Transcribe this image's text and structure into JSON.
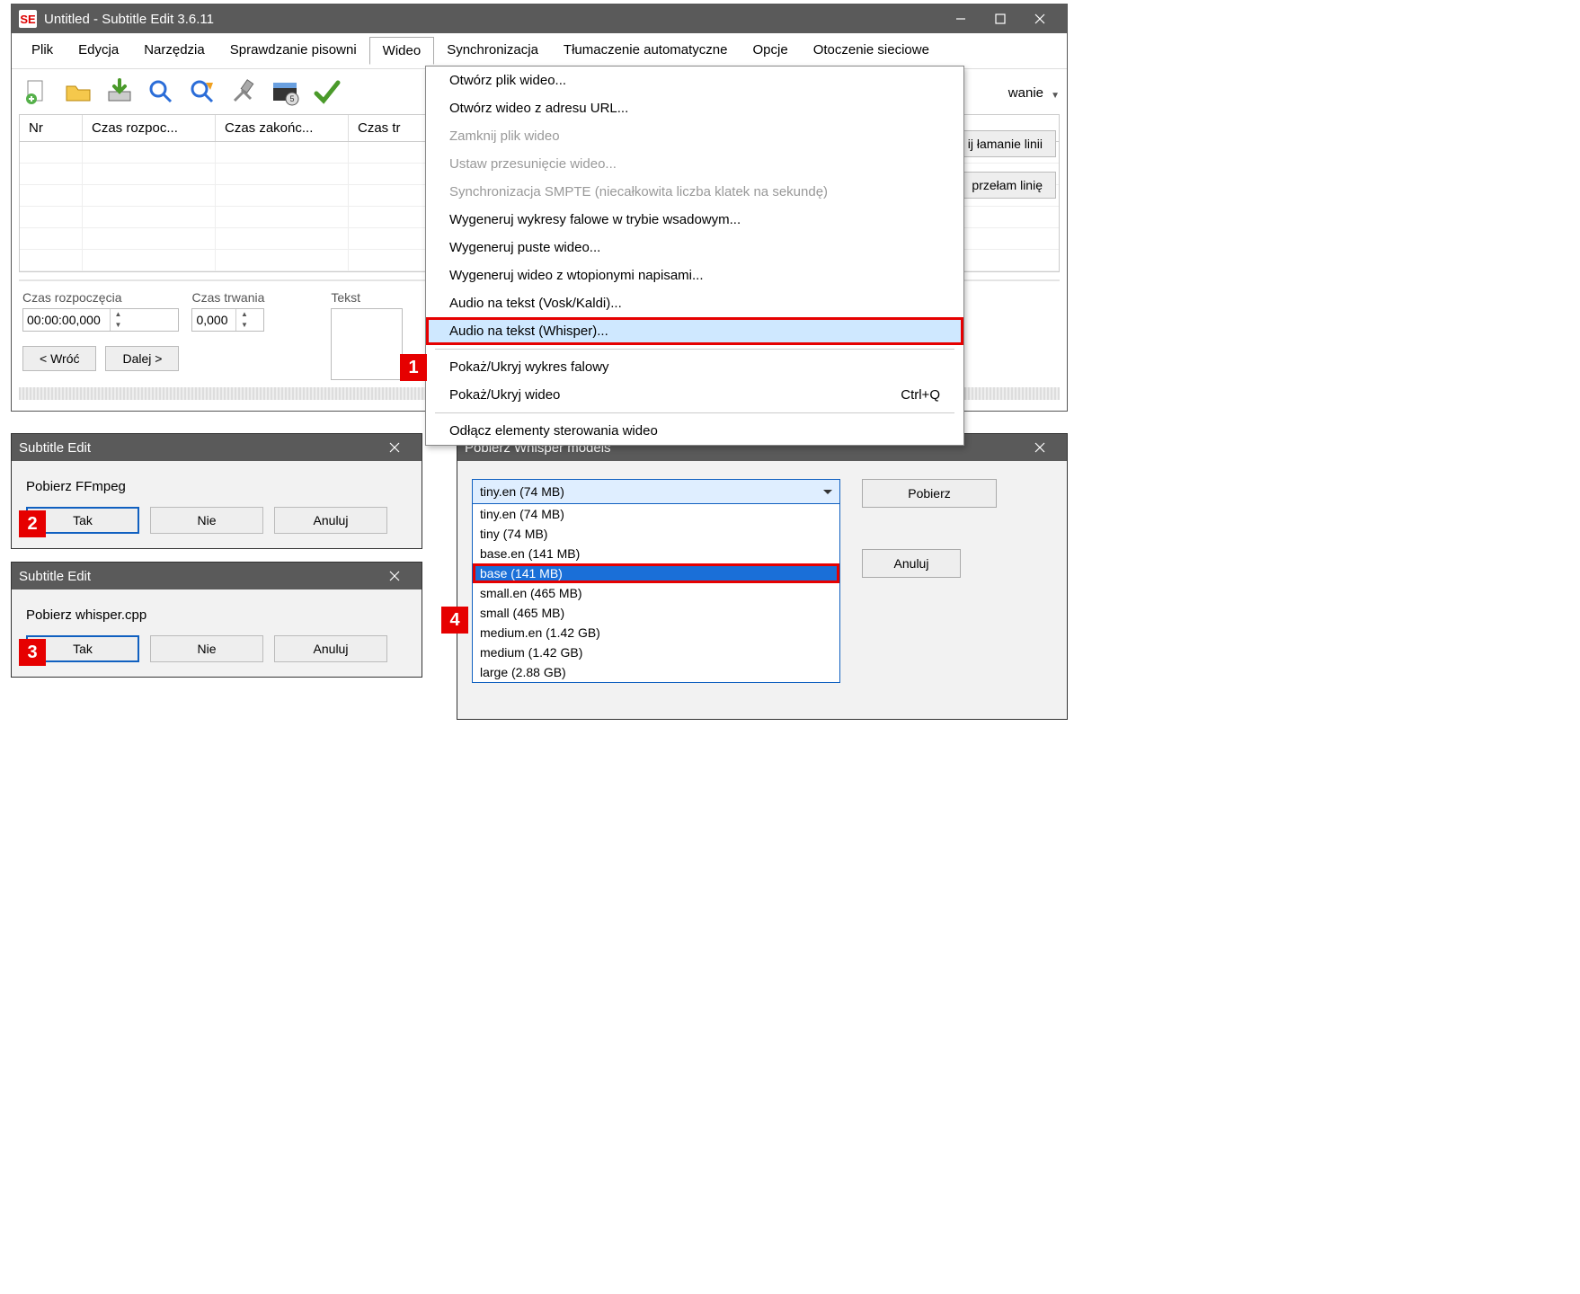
{
  "main": {
    "app_icon_text": "SE",
    "title": "Untitled - Subtitle Edit 3.6.11",
    "menubar": [
      "Plik",
      "Edycja",
      "Narzędzia",
      "Sprawdzanie pisowni",
      "Wideo",
      "Synchronizacja",
      "Tłumaczenie automatyczne",
      "Opcje",
      "Otoczenie sieciowe"
    ],
    "active_menu_index": 4,
    "grid_head": [
      "Nr",
      "Czas rozpoc...",
      "Czas zakońc...",
      "Czas tr"
    ],
    "lower": {
      "start_lbl": "Czas rozpoczęcia",
      "start_val": "00:00:00,000",
      "dur_lbl": "Czas trwania",
      "dur_val": "0,000",
      "text_lbl": "Tekst",
      "back": "< Wróć",
      "next": "Dalej >",
      "btn_a_suffix": "ij łamanie linii",
      "btn_b_suffix": "przełam linię",
      "track_word": "wanie"
    }
  },
  "video_menu": {
    "items": [
      {
        "label": "Otwórz plik wideo...",
        "disabled": false
      },
      {
        "label": "Otwórz wideo z adresu URL...",
        "disabled": false
      },
      {
        "label": "Zamknij plik wideo",
        "disabled": true
      },
      {
        "label": "Ustaw przesunięcie wideo...",
        "disabled": true
      },
      {
        "label": "Synchronizacja SMPTE (niecałkowita liczba klatek na sekundę)",
        "disabled": true
      },
      {
        "label": "Wygeneruj wykresy falowe w trybie wsadowym...",
        "disabled": false
      },
      {
        "label": "Wygeneruj puste wideo...",
        "disabled": false
      },
      {
        "label": "Wygeneruj wideo z wtopionymi napisami...",
        "disabled": false
      },
      {
        "label": "Audio na tekst (Vosk/Kaldi)...",
        "disabled": false
      },
      {
        "label": "Audio na tekst (Whisper)...",
        "disabled": false,
        "highlight": true,
        "sep_after": true
      },
      {
        "label": "Pokaż/Ukryj wykres falowy",
        "disabled": false
      },
      {
        "label": "Pokaż/Ukryj wideo",
        "disabled": false,
        "accel": "Ctrl+Q",
        "sep_after": true
      },
      {
        "label": "Odłącz elementy sterowania wideo",
        "disabled": false
      }
    ]
  },
  "dlg_ffmpeg": {
    "title": "Subtitle Edit",
    "msg": "Pobierz FFmpeg",
    "yes": "Tak",
    "no": "Nie",
    "cancel": "Anuluj"
  },
  "dlg_whisper": {
    "title": "Subtitle Edit",
    "msg": "Pobierz whisper.cpp",
    "yes": "Tak",
    "no": "Nie",
    "cancel": "Anuluj"
  },
  "dlg_models": {
    "title": "Pobierz Whisper models",
    "download": "Pobierz",
    "cancel": "Anuluj",
    "selected": "tiny.en (74 MB)",
    "options": [
      "tiny.en (74 MB)",
      "tiny (74 MB)",
      "base.en (141 MB)",
      "base (141 MB)",
      "small.en (465 MB)",
      "small (465 MB)",
      "medium.en (1.42 GB)",
      "medium (1.42 GB)",
      "large (2.88 GB)"
    ],
    "highlight_index": 3
  },
  "badges": {
    "b1": "1",
    "b2": "2",
    "b3": "3",
    "b4": "4"
  }
}
